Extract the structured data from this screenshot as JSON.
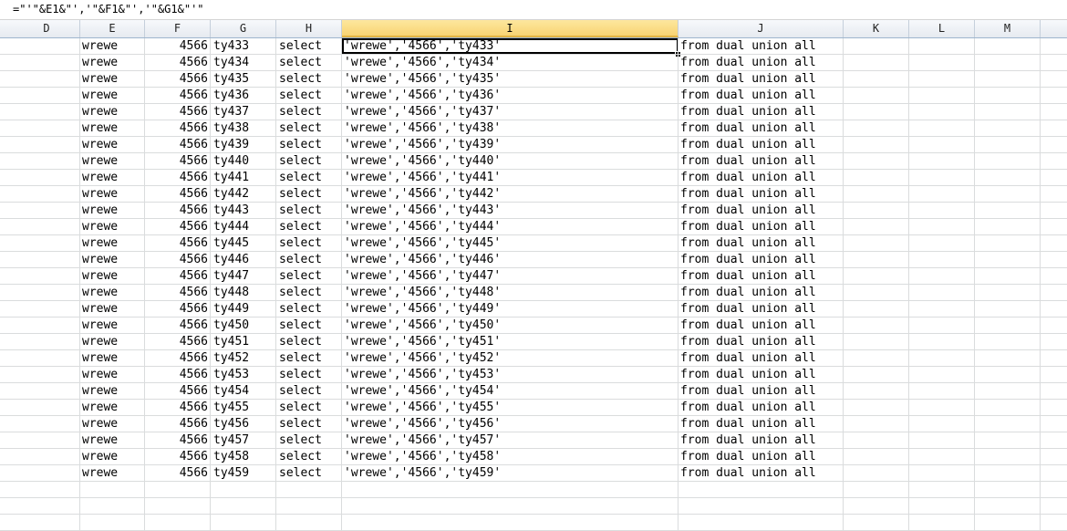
{
  "formula_bar": {
    "content": "=\"'\"&E1&\"','\"&F1&\"','\"&G1&\"'\""
  },
  "columns": [
    {
      "label": "D"
    },
    {
      "label": "E"
    },
    {
      "label": "F"
    },
    {
      "label": "G"
    },
    {
      "label": "H"
    },
    {
      "label": "I",
      "selected": true
    },
    {
      "label": "J"
    },
    {
      "label": "K"
    },
    {
      "label": "L"
    },
    {
      "label": "M"
    }
  ],
  "rows": [
    {
      "e": "wrewe",
      "f": "4566",
      "g": "ty433",
      "h": "select",
      "i": "'wrewe','4566','ty433'",
      "j": "from dual union all"
    },
    {
      "e": "wrewe",
      "f": "4566",
      "g": "ty434",
      "h": "select",
      "i": "'wrewe','4566','ty434'",
      "j": "from dual union all"
    },
    {
      "e": "wrewe",
      "f": "4566",
      "g": "ty435",
      "h": "select",
      "i": "'wrewe','4566','ty435'",
      "j": "from dual union all"
    },
    {
      "e": "wrewe",
      "f": "4566",
      "g": "ty436",
      "h": "select",
      "i": "'wrewe','4566','ty436'",
      "j": "from dual union all"
    },
    {
      "e": "wrewe",
      "f": "4566",
      "g": "ty437",
      "h": "select",
      "i": "'wrewe','4566','ty437'",
      "j": "from dual union all"
    },
    {
      "e": "wrewe",
      "f": "4566",
      "g": "ty438",
      "h": "select",
      "i": "'wrewe','4566','ty438'",
      "j": "from dual union all"
    },
    {
      "e": "wrewe",
      "f": "4566",
      "g": "ty439",
      "h": "select",
      "i": "'wrewe','4566','ty439'",
      "j": "from dual union all"
    },
    {
      "e": "wrewe",
      "f": "4566",
      "g": "ty440",
      "h": "select",
      "i": "'wrewe','4566','ty440'",
      "j": "from dual union all"
    },
    {
      "e": "wrewe",
      "f": "4566",
      "g": "ty441",
      "h": "select",
      "i": "'wrewe','4566','ty441'",
      "j": "from dual union all"
    },
    {
      "e": "wrewe",
      "f": "4566",
      "g": "ty442",
      "h": "select",
      "i": "'wrewe','4566','ty442'",
      "j": "from dual union all"
    },
    {
      "e": "wrewe",
      "f": "4566",
      "g": "ty443",
      "h": "select",
      "i": "'wrewe','4566','ty443'",
      "j": "from dual union all"
    },
    {
      "e": "wrewe",
      "f": "4566",
      "g": "ty444",
      "h": "select",
      "i": "'wrewe','4566','ty444'",
      "j": "from dual union all"
    },
    {
      "e": "wrewe",
      "f": "4566",
      "g": "ty445",
      "h": "select",
      "i": "'wrewe','4566','ty445'",
      "j": "from dual union all"
    },
    {
      "e": "wrewe",
      "f": "4566",
      "g": "ty446",
      "h": "select",
      "i": "'wrewe','4566','ty446'",
      "j": "from dual union all"
    },
    {
      "e": "wrewe",
      "f": "4566",
      "g": "ty447",
      "h": "select",
      "i": "'wrewe','4566','ty447'",
      "j": "from dual union all"
    },
    {
      "e": "wrewe",
      "f": "4566",
      "g": "ty448",
      "h": "select",
      "i": "'wrewe','4566','ty448'",
      "j": "from dual union all"
    },
    {
      "e": "wrewe",
      "f": "4566",
      "g": "ty449",
      "h": "select",
      "i": "'wrewe','4566','ty449'",
      "j": "from dual union all"
    },
    {
      "e": "wrewe",
      "f": "4566",
      "g": "ty450",
      "h": "select",
      "i": "'wrewe','4566','ty450'",
      "j": "from dual union all"
    },
    {
      "e": "wrewe",
      "f": "4566",
      "g": "ty451",
      "h": "select",
      "i": "'wrewe','4566','ty451'",
      "j": "from dual union all"
    },
    {
      "e": "wrewe",
      "f": "4566",
      "g": "ty452",
      "h": "select",
      "i": "'wrewe','4566','ty452'",
      "j": "from dual union all"
    },
    {
      "e": "wrewe",
      "f": "4566",
      "g": "ty453",
      "h": "select",
      "i": "'wrewe','4566','ty453'",
      "j": "from dual union all"
    },
    {
      "e": "wrewe",
      "f": "4566",
      "g": "ty454",
      "h": "select",
      "i": "'wrewe','4566','ty454'",
      "j": "from dual union all"
    },
    {
      "e": "wrewe",
      "f": "4566",
      "g": "ty455",
      "h": "select",
      "i": "'wrewe','4566','ty455'",
      "j": "from dual union all"
    },
    {
      "e": "wrewe",
      "f": "4566",
      "g": "ty456",
      "h": "select",
      "i": "'wrewe','4566','ty456'",
      "j": "from dual union all"
    },
    {
      "e": "wrewe",
      "f": "4566",
      "g": "ty457",
      "h": "select",
      "i": "'wrewe','4566','ty457'",
      "j": "from dual union all"
    },
    {
      "e": "wrewe",
      "f": "4566",
      "g": "ty458",
      "h": "select",
      "i": "'wrewe','4566','ty458'",
      "j": "from dual union all"
    },
    {
      "e": "wrewe",
      "f": "4566",
      "g": "ty459",
      "h": "select",
      "i": "'wrewe','4566','ty459'",
      "j": "from dual union all"
    }
  ],
  "colors": {
    "selected_header": "#f8d473",
    "gridline": "#dadcdd",
    "header_bg": "#e6eaf0"
  }
}
